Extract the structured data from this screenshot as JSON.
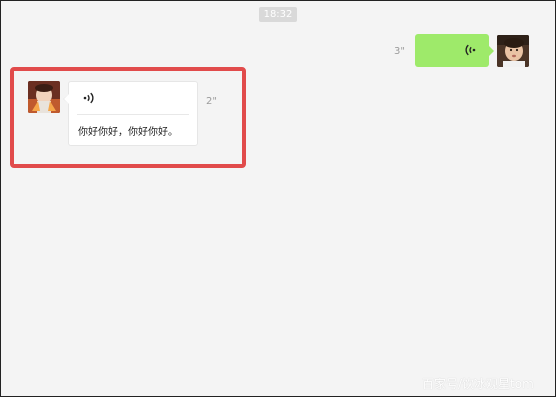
{
  "chat": {
    "timestamp": "18:32",
    "outgoing": {
      "duration": "3\"",
      "icon": "voice-wave-icon",
      "bubble_color": "#9eea6a"
    },
    "incoming": {
      "duration": "2\"",
      "icon": "voice-wave-icon",
      "transcription": "你好你好，你好你好。"
    }
  },
  "highlight_color": "#e14b4b",
  "watermark": "百家号/饮冰观星tom"
}
